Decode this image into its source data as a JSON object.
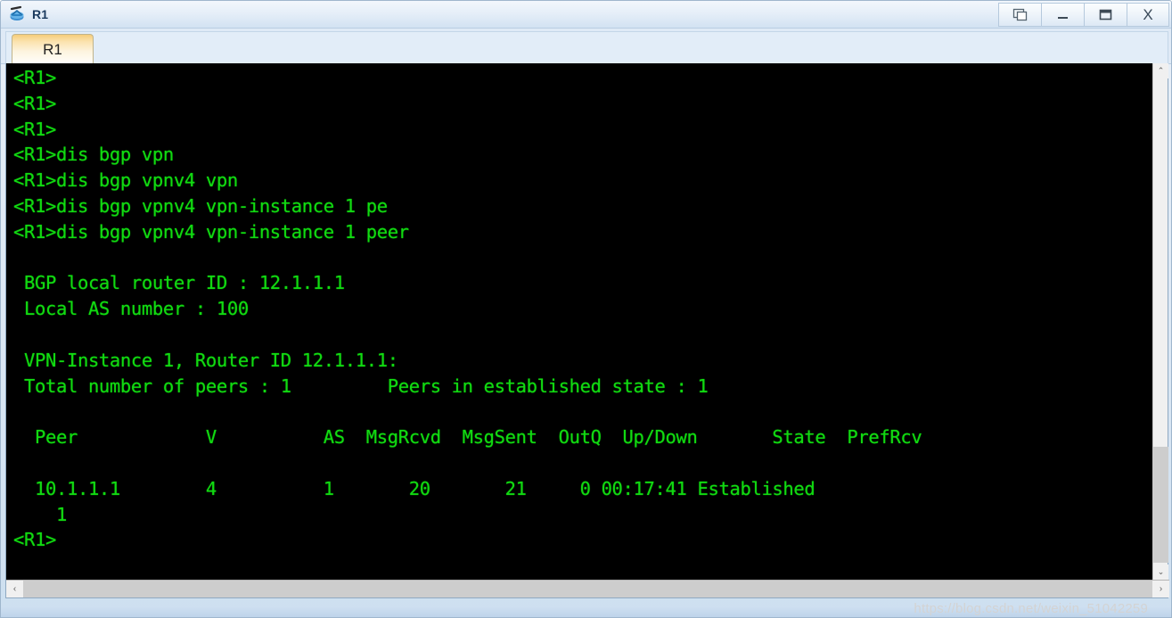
{
  "window": {
    "title": "R1",
    "icon": "router-icon",
    "buttons": [
      {
        "name": "restore-window-button",
        "label": "❐",
        "glyph": "cascade-windows-icon"
      },
      {
        "name": "minimize-button",
        "label": "–",
        "glyph": "minimize-icon"
      },
      {
        "name": "maximize-button",
        "label": "❑",
        "glyph": "maximize-icon"
      },
      {
        "name": "close-button",
        "label": "X",
        "glyph": "close-icon"
      }
    ]
  },
  "tabs": [
    {
      "label": "R1",
      "active": true
    }
  ],
  "terminal": {
    "foreground": "#12d912",
    "background": "#000000",
    "content": "<R1>\n<R1>\n<R1>\n<R1>dis bgp vpn\n<R1>dis bgp vpnv4 vpn\n<R1>dis bgp vpnv4 vpn-instance 1 pe\n<R1>dis bgp vpnv4 vpn-instance 1 peer\n\n BGP local router ID : 12.1.1.1\n Local AS number : 100\n\n VPN-Instance 1, Router ID 12.1.1.1:\n Total number of peers : 1         Peers in established state : 1\n\n  Peer            V          AS  MsgRcvd  MsgSent  OutQ  Up/Down       State  PrefRcv\n\n  10.1.1.1        4          1       20       21     0 00:17:41 Established\n    1\n<R1>",
    "lines": [
      "<R1>",
      "<R1>",
      "<R1>",
      "<R1>dis bgp vpn",
      "<R1>dis bgp vpnv4 vpn",
      "<R1>dis bgp vpnv4 vpn-instance 1 pe",
      "<R1>dis bgp vpnv4 vpn-instance 1 peer",
      "",
      " BGP local router ID : 12.1.1.1",
      " Local AS number : 100",
      "",
      " VPN-Instance 1, Router ID 12.1.1.1:",
      " Total number of peers : 1         Peers in established state : 1",
      "",
      "  Peer            V          AS  MsgRcvd  MsgSent  OutQ  Up/Down       State  PrefRcv",
      "",
      "  10.1.1.1        4          1       20       21     0 00:17:41 Established",
      "    1",
      "<R1>"
    ],
    "bgp_summary": {
      "bgp_local_router_id": "12.1.1.1",
      "local_as_number": "100",
      "vpn_instance": "1",
      "vpn_instance_router_id": "12.1.1.1",
      "total_number_of_peers": "1",
      "peers_in_established_state": "1",
      "table_headers": [
        "Peer",
        "V",
        "AS",
        "MsgRcvd",
        "MsgSent",
        "OutQ",
        "Up/Down",
        "State",
        "PrefRcv"
      ],
      "table_rows": [
        [
          "10.1.1.1",
          "4",
          "1",
          "20",
          "21",
          "0",
          "00:17:41",
          "Established",
          "1"
        ]
      ]
    }
  },
  "scrollbars": {
    "vertical": {
      "up_arrow": "⌃",
      "down_arrow": "⌄"
    },
    "horizontal": {
      "left_arrow": "‹",
      "right_arrow": "›"
    }
  },
  "watermark": {
    "text": "https://blog.csdn.net/weixin_51042259"
  }
}
